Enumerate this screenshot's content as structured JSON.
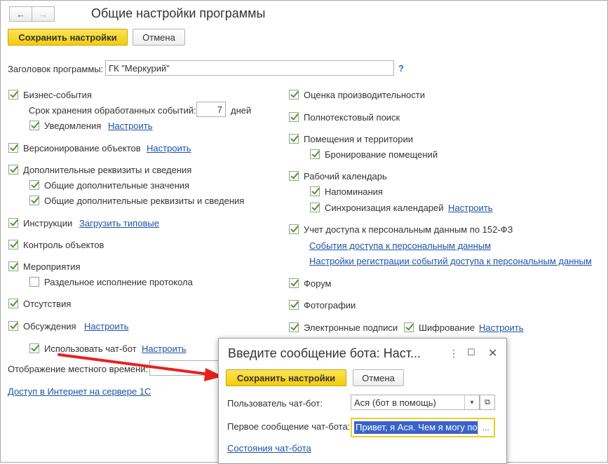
{
  "window": {
    "title": "Общие настройки программы",
    "save_label": "Сохранить настройки",
    "cancel_label": "Отмена"
  },
  "header_field": {
    "label": "Заголовок программы:",
    "value": "ГК \"Меркурий\"",
    "help": "?"
  },
  "left": {
    "business_events": "Бизнес-события",
    "retention_label": "Срок хранения обработанных событий:",
    "retention_value": "7",
    "retention_unit": "дней",
    "notifications": "Уведомления",
    "notifications_link": "Настроить",
    "versioning": "Версионирование объектов",
    "versioning_link": "Настроить",
    "additional": "Дополнительные реквизиты и сведения",
    "additional_values": "Общие дополнительные значения",
    "additional_details": "Общие дополнительные реквизиты и сведения",
    "instructions": "Инструкции",
    "instructions_link": "Загрузить типовые",
    "object_control": "Контроль объектов",
    "events": "Мероприятия",
    "separate_protocol": "Раздельное исполнение протокола",
    "absences": "Отсутствия",
    "discussions": "Обсуждения",
    "discussions_link": "Настроить",
    "chatbot": "Использовать чат-бот",
    "chatbot_link": "Настроить",
    "local_time": "Отображение местного времени:",
    "internet_link": "Доступ в Интернет на сервере 1С"
  },
  "right": {
    "performance": "Оценка производительности",
    "fulltext": "Полнотекстовый поиск",
    "premises": "Помещения и территории",
    "booking": "Бронирование помещений",
    "calendar": "Рабочий календарь",
    "reminders": "Напоминания",
    "sync": "Синхронизация календарей",
    "sync_link": "Настроить",
    "personal_data": "Учет доступа к персональным данным по 152-ФЗ",
    "pd_events_link": "События доступа к персональным данным",
    "pd_settings_link": "Настройки регистрации событий доступа к персональным данным",
    "forum": "Форум",
    "photos": "Фотографии",
    "esign": "Электронные подписи",
    "encryption": "Шифрование",
    "encryption_link": "Настроить"
  },
  "dialog": {
    "title": "Введите сообщение бота: Наст...",
    "save_label": "Сохранить настройки",
    "cancel_label": "Отмена",
    "user_label": "Пользователь чат-бот:",
    "user_value": "Ася (бот в помощь)",
    "first_message_label": "Первое сообщение чат-бота:",
    "first_message_value": "Привет, я Ася. Чем я могу по",
    "states_link": "Состояния чат-бота",
    "dots": "..."
  },
  "colors": {
    "accent_button": "#f3cc0b",
    "link": "#1c53a6",
    "arrow": "#e8201c",
    "check": "#4d9a2a"
  }
}
